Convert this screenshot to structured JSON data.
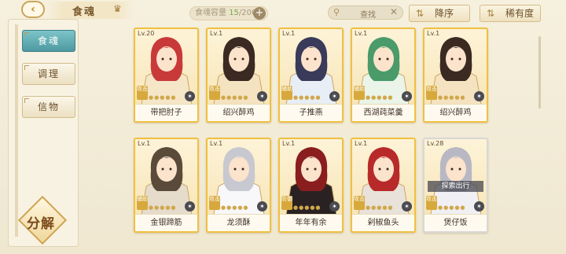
{
  "header": {
    "title": "食魂",
    "capacity_label": "食魂容量",
    "capacity_count": "15",
    "capacity_max": "/200",
    "search_placeholder": "查找",
    "sort_order_label": "降序",
    "sort_rarity_label": "稀有度"
  },
  "sidebar": {
    "tabs": [
      {
        "label": "食魂",
        "active": true
      },
      {
        "label": "调理",
        "active": false
      },
      {
        "label": "信物",
        "active": false
      }
    ],
    "decompose_label": "分解"
  },
  "cards": [
    {
      "level": "Lv.20",
      "name": "带把肘子",
      "role": "攻击",
      "palette": [
        "#c83a3a",
        "#f5e6c8"
      ]
    },
    {
      "level": "Lv.1",
      "name": "绍兴醉鸡",
      "role": "攻击",
      "palette": [
        "#3a2a22",
        "#f5e2c0"
      ]
    },
    {
      "level": "Lv.1",
      "name": "子推燕",
      "role": "辅助",
      "palette": [
        "#3a3a5a",
        "#e8eef6"
      ]
    },
    {
      "level": "Lv.1",
      "name": "西湖莼菜羹",
      "role": "辅助",
      "palette": [
        "#4a9a6a",
        "#eaf4e8"
      ]
    },
    {
      "level": "Lv.1",
      "name": "绍兴醉鸡",
      "role": "攻击",
      "palette": [
        "#3a2a22",
        "#f5e2c0"
      ]
    },
    {
      "level": "Lv.1",
      "name": "金银蹄筋",
      "role": "辅助",
      "palette": [
        "#5a4a3a",
        "#e6dccc"
      ]
    },
    {
      "level": "Lv.1",
      "name": "龙须酥",
      "role": "攻击",
      "palette": [
        "#c8c8d0",
        "#f8f8fa"
      ]
    },
    {
      "level": "Lv.1",
      "name": "年年有余",
      "role": "防御",
      "palette": [
        "#8a1e1e",
        "#2a2222"
      ]
    },
    {
      "level": "Lv.1",
      "name": "剁椒鱼头",
      "role": "攻击",
      "palette": [
        "#b82a2a",
        "#e8e2da"
      ]
    },
    {
      "level": "Lv.28",
      "name": "煲仔饭",
      "role": "攻击",
      "palette": [
        "#b8b8c4",
        "#f0f0f4"
      ],
      "status": "探索出行",
      "white": true
    }
  ]
}
